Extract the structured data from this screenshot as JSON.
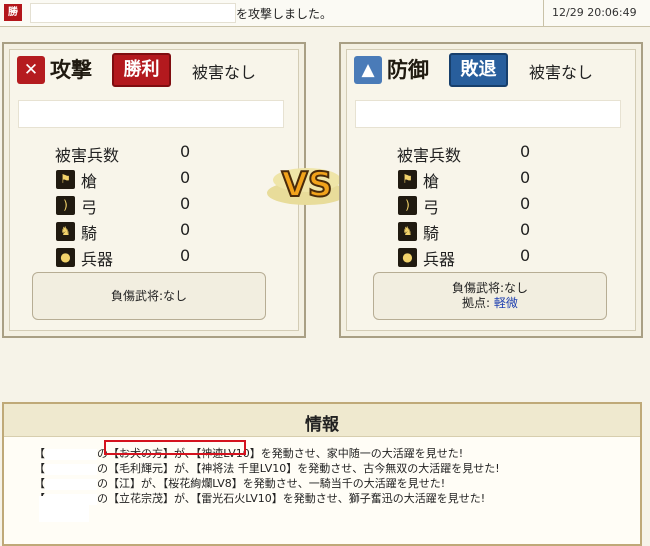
{
  "topbar": {
    "badge": "勝",
    "message": "を攻撃しました。",
    "timestamp": "12/29 20:06:49"
  },
  "attacker": {
    "label": "攻撃",
    "result": "勝利",
    "damage_summary": "被害なし",
    "casualties_label": "被害兵数",
    "casualties_value": "0",
    "units": [
      {
        "name": "槍",
        "icon": "spear-icon",
        "value": "0"
      },
      {
        "name": "弓",
        "icon": "bow-icon",
        "value": "0"
      },
      {
        "name": "騎",
        "icon": "horse-icon",
        "value": "0"
      },
      {
        "name": "兵器",
        "icon": "siege-weapon-icon",
        "value": "0"
      }
    ],
    "injury_text": "負傷武将:なし"
  },
  "defender": {
    "label": "防御",
    "result": "敗退",
    "damage_summary": "被害なし",
    "casualties_label": "被害兵数",
    "casualties_value": "0",
    "units": [
      {
        "name": "槍",
        "icon": "spear-icon",
        "value": "0"
      },
      {
        "name": "弓",
        "icon": "bow-icon",
        "value": "0"
      },
      {
        "name": "騎",
        "icon": "horse-icon",
        "value": "0"
      },
      {
        "name": "兵器",
        "icon": "siege-weapon-icon",
        "value": "0"
      }
    ],
    "injury_text": "負傷武将:なし",
    "base_label": "拠点:",
    "base_damage": "軽微"
  },
  "vs_text": "VS",
  "info": {
    "title": "情報",
    "log": [
      {
        "lead": "【",
        "rest": "の【お犬の方】が、【神速LV10】を発動させ、家中随一の大活躍を見せた!"
      },
      {
        "lead": "【",
        "rest": "の【毛利輝元】が、【神将法 千里LV10】を発動させ、古今無双の大活躍を見せた!"
      },
      {
        "lead": "【",
        "rest": "の【江】が、【桜花絢爛LV8】を発動させ、一騎当千の大活躍を見せた!"
      },
      {
        "lead": "【",
        "rest": "の【立花宗茂】が、【雷光石火LV10】を発動させ、獅子奮迅の大活躍を見せた!"
      }
    ]
  },
  "colors": {
    "win_red": "#b3191e",
    "lose_blue": "#285e9c",
    "highlight_red": "#d4121e"
  }
}
